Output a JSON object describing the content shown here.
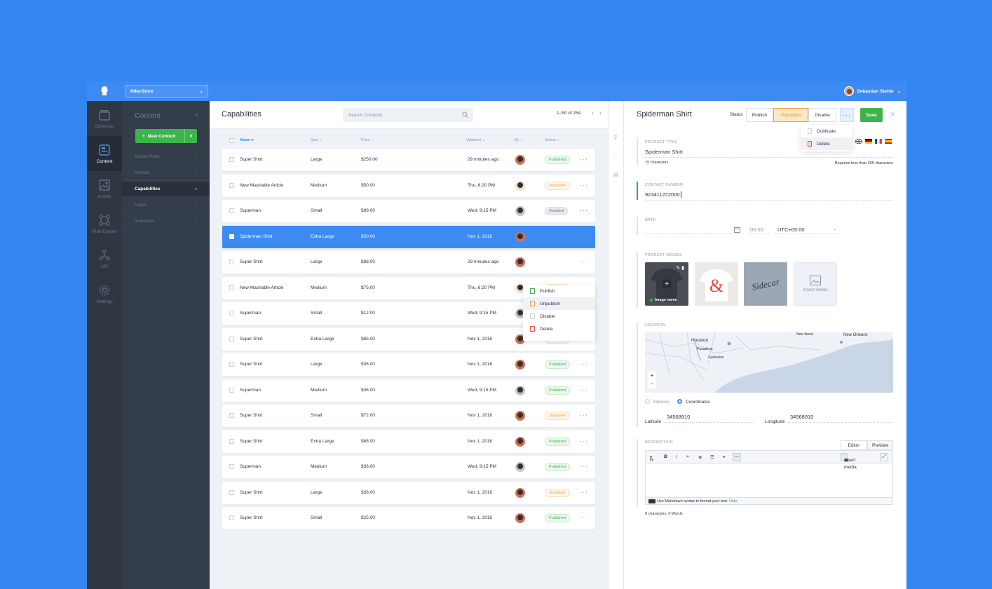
{
  "topbar": {
    "store": "Nike-Store",
    "user": "Sebastian Stehle"
  },
  "rail": [
    {
      "label": "Schemas",
      "icon": "schemas-icon"
    },
    {
      "label": "Content",
      "icon": "content-icon"
    },
    {
      "label": "Assets",
      "icon": "assets-icon"
    },
    {
      "label": "Rule Engine",
      "icon": "rule-engine-icon"
    },
    {
      "label": "API",
      "icon": "api-icon"
    },
    {
      "label": "Settings",
      "icon": "settings-icon"
    }
  ],
  "subnav": {
    "title": "Content",
    "close": "×",
    "new_button": "New Content",
    "items": [
      {
        "label": "Social Posts"
      },
      {
        "label": "Articles"
      },
      {
        "label": "Capabilities"
      },
      {
        "label": "Legal"
      },
      {
        "label": "Industries"
      }
    ]
  },
  "list": {
    "title": "Capabilities",
    "search_placeholder": "Search Contents",
    "pager": "1–50 of 254",
    "columns": {
      "name": "Name",
      "size": "Size",
      "price": "Price",
      "updated": "Updated",
      "by": "By",
      "status": "Status"
    },
    "rows": [
      {
        "name": "Super Shirt",
        "size": "Large",
        "price": "$250.00",
        "updated": "29 minutes ago",
        "status": "Published"
      },
      {
        "name": "New Mashable Article",
        "size": "Medium",
        "price": "$50.00",
        "updated": "Thu, 6:20 PM",
        "status": "Unpublish"
      },
      {
        "name": "Superman",
        "size": "Small",
        "price": "$99.00",
        "updated": "Wed, 9:15 PM",
        "status": "Disabled"
      },
      {
        "name": "Spiderman Shirt",
        "size": "Extra Large",
        "price": "$50.00",
        "updated": "Nov 1, 2016",
        "status": ""
      },
      {
        "name": "Super Shirt",
        "size": "Large",
        "price": "$88.00",
        "updated": "29 minutes ago",
        "status": ""
      },
      {
        "name": "New Mashable Article",
        "size": "Medium",
        "price": "$75.00",
        "updated": "Thu, 6:20 PM",
        "status": "Unpublish"
      },
      {
        "name": "Superman",
        "size": "Small",
        "price": "$12.00",
        "updated": "Wed, 9:15 PM",
        "status": "Published"
      },
      {
        "name": "Super Shirt",
        "size": "Extra Large",
        "price": "$85.00",
        "updated": "Nov 1, 2016",
        "status": "Unpublish"
      },
      {
        "name": "Super Shirt",
        "size": "Large",
        "price": "$36.00",
        "updated": "Nov 1, 2016",
        "status": "Published"
      },
      {
        "name": "Superman",
        "size": "Medium",
        "price": "$36.00",
        "updated": "Wed, 9:15 PM",
        "status": "Published"
      },
      {
        "name": "Super Shirt",
        "size": "Small",
        "price": "$72.00",
        "updated": "Nov 1, 2016",
        "status": "Unpublish"
      },
      {
        "name": "Super Shirt",
        "size": "Extra Large",
        "price": "$88.00",
        "updated": "Nov 1, 2016",
        "status": "Published"
      },
      {
        "name": "Superman",
        "size": "Medium",
        "price": "$36.00",
        "updated": "Wed, 9:15 PM",
        "status": "Published"
      },
      {
        "name": "Super Shirt",
        "size": "Large",
        "price": "$36.00",
        "updated": "Nov 1, 2016",
        "status": "Unpublish"
      },
      {
        "name": "Super Shirt",
        "size": "Small",
        "price": "$25.00",
        "updated": "Nov 1, 2016",
        "status": "Published"
      }
    ],
    "row_menu": [
      "Publish",
      "Unpublish",
      "Disable",
      "Delete"
    ]
  },
  "editor": {
    "title": "Spiderman Shirt",
    "status_label": "Status",
    "buttons": {
      "publish": "Publish",
      "unpublish": "Unpublish",
      "disable": "Disable",
      "more": "···",
      "save": "Save"
    },
    "more_menu": [
      "Dublicate",
      "Delete"
    ],
    "product_title": {
      "label": "Product Title",
      "value": "Spiderman Shirt",
      "count": "15 characters",
      "hint": "Requires less than 256 characters"
    },
    "contact": {
      "label": "Contact Number",
      "value": "923411222000"
    },
    "date": {
      "label": "Date",
      "time": "00:00",
      "zone": "UTC+05:00"
    },
    "images": {
      "label": "Product Images",
      "image_name": "Image name",
      "import": "Import Media"
    },
    "location": {
      "label": "Location",
      "cities": [
        "Houston",
        "Pasadena",
        "Galveston",
        "New Iberia",
        "New Orleans"
      ],
      "address": "Address",
      "coordinates": "Coordinates",
      "latitude_label": "Latitude",
      "latitude": "34568910",
      "longitude_label": "Longitude",
      "longitude": "34568910"
    },
    "description": {
      "label": "Description",
      "tab_editor": "Editor",
      "tab_preview": "Preview",
      "toolbar": [
        "H",
        "B",
        "I",
        "❝",
        "≣",
        "☰",
        "⚭",
        "—"
      ],
      "insert_media": "Insert media",
      "md_hint": "Use Markdown syntax to format your text.",
      "md_help": "Help",
      "counts": "0 characters, 0 Words"
    }
  },
  "colors": {
    "accent": "#3d8bf2",
    "success": "#3cb44b",
    "warning": "#f0a142",
    "danger": "#e8494b"
  }
}
